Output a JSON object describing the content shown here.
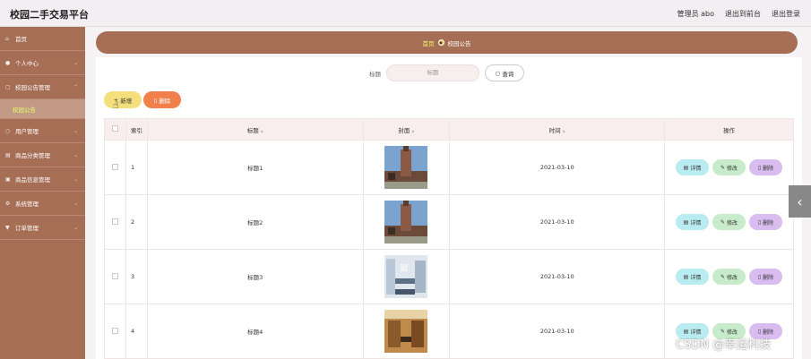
{
  "header": {
    "brand": "校园二手交易平台",
    "admin": "管理员 abo",
    "back_front": "退出到前台",
    "logout": "退出登录"
  },
  "sidebar": {
    "items": [
      {
        "label": "首页",
        "icon": "home-icon"
      },
      {
        "label": "个人中心",
        "icon": "user-icon"
      },
      {
        "label": "校园公告管理",
        "icon": "notice-icon",
        "sub": "校园公告"
      },
      {
        "label": "用户管理",
        "icon": "users-icon"
      },
      {
        "label": "商品分类管理",
        "icon": "category-icon"
      },
      {
        "label": "商品信息管理",
        "icon": "goods-icon"
      },
      {
        "label": "系统管理",
        "icon": "system-icon"
      },
      {
        "label": "订单管理",
        "icon": "order-icon"
      }
    ]
  },
  "breadcrumb": {
    "home": "首页",
    "current": "校园公告"
  },
  "search": {
    "label": "标题",
    "placeholder": "标题",
    "button": "查询"
  },
  "toolbar": {
    "add": "新增",
    "delete": "删除"
  },
  "table": {
    "headers": [
      "索引",
      "标题",
      "封面",
      "时间",
      "操作"
    ],
    "rows": [
      {
        "index": "1",
        "title": "标题1",
        "time": "2021-03-10"
      },
      {
        "index": "2",
        "title": "标题2",
        "time": "2021-03-10"
      },
      {
        "index": "3",
        "title": "标题3",
        "time": "2021-03-10"
      },
      {
        "index": "4",
        "title": "标题4",
        "time": "2021-03-10"
      }
    ],
    "ops": {
      "detail": "详情",
      "edit": "修改",
      "remove": "删除"
    }
  },
  "watermark": "CSDN @幸运科技"
}
